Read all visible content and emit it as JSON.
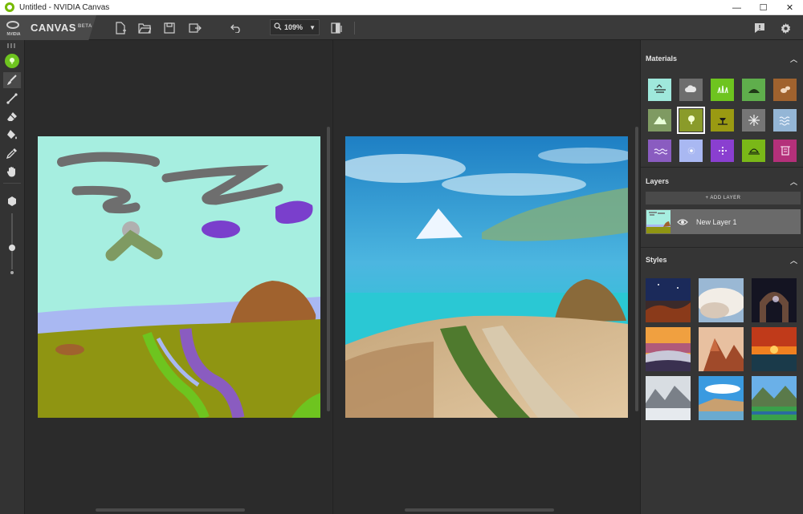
{
  "window": {
    "title": "Untitled - NVIDIA Canvas",
    "minimize": "—",
    "maximize": "☐",
    "close": "✕"
  },
  "brand": {
    "logo_text": "NVIDIA",
    "name": "CANVAS",
    "badge": "BETA"
  },
  "toolbar": {
    "zoom_value": "109%",
    "zoom_caret": "▼"
  },
  "materials": {
    "title": "Materials",
    "items": [
      {
        "name": "water",
        "color": "#9fe8dc"
      },
      {
        "name": "cloud",
        "color": "#6e6e6e"
      },
      {
        "name": "grass",
        "color": "#6ec41f"
      },
      {
        "name": "hill",
        "color": "#5fae4c"
      },
      {
        "name": "rock",
        "color": "#a0622e"
      },
      {
        "name": "mountain",
        "color": "#7f9a62"
      },
      {
        "name": "tree",
        "color": "#8a9b2a"
      },
      {
        "name": "bush",
        "color": "#9a9a12"
      },
      {
        "name": "snow",
        "color": "#767676"
      },
      {
        "name": "sea",
        "color": "#94b6d6"
      },
      {
        "name": "river",
        "color": "#8a5cc0"
      },
      {
        "name": "fog",
        "color": "#a9b8f2"
      },
      {
        "name": "flower",
        "color": "#8a3fd0"
      },
      {
        "name": "sand",
        "color": "#7ab818"
      },
      {
        "name": "building",
        "color": "#b4307a"
      }
    ]
  },
  "layers": {
    "title": "Layers",
    "add_label": "+ ADD LAYER",
    "items": [
      {
        "name": "New Layer 1"
      }
    ]
  },
  "styles": {
    "title": "Styles",
    "items": [
      {
        "name": "style-desert-night"
      },
      {
        "name": "style-clouds"
      },
      {
        "name": "style-arch-stars"
      },
      {
        "name": "style-sunset-fog"
      },
      {
        "name": "style-red-rocks"
      },
      {
        "name": "style-ocean-sunset"
      },
      {
        "name": "style-misty-peaks"
      },
      {
        "name": "style-blue-sky-cliffs"
      },
      {
        "name": "style-green-valley"
      }
    ]
  },
  "icons": {
    "new": "new-file-icon",
    "open": "open-folder-icon",
    "save": "save-icon",
    "export": "export-icon",
    "undo": "undo-icon",
    "search": "search-icon",
    "compare": "compare-view-icon",
    "feedback": "feedback-icon",
    "settings": "gear-icon"
  }
}
